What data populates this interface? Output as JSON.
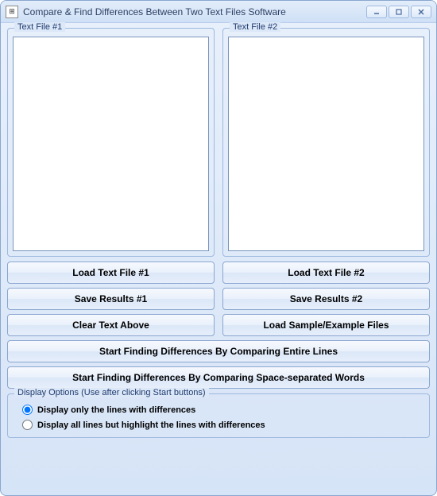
{
  "window": {
    "title": "Compare & Find Differences Between Two Text Files Software"
  },
  "panels": {
    "file1_label": "Text File #1",
    "file2_label": "Text File #2",
    "file1_value": "",
    "file2_value": ""
  },
  "buttons": {
    "load1": "Load Text File #1",
    "load2": "Load Text File #2",
    "save1": "Save Results #1",
    "save2": "Save Results #2",
    "clear": "Clear Text Above",
    "sample": "Load Sample/Example Files",
    "start_lines": "Start Finding Differences By Comparing Entire Lines",
    "start_words": "Start Finding Differences By Comparing Space-separated Words"
  },
  "display_options": {
    "legend": "Display Options (Use after clicking Start buttons)",
    "opt1": "Display only the lines with differences",
    "opt2": "Display all lines but highlight the lines with differences",
    "selected": "opt1"
  }
}
